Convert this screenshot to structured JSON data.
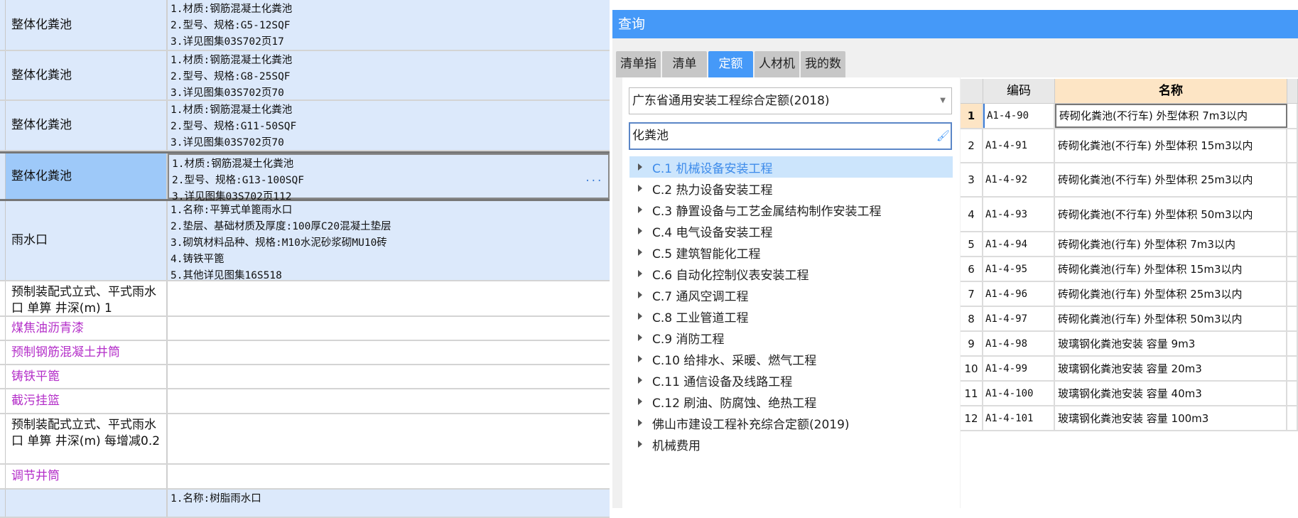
{
  "grid": {
    "rows": [
      {
        "name": "整体化粪池",
        "desc": "1.材质:钢筋混凝土化粪池\n2.型号、规格:G5-12SQF\n3.详见图集03S702页17",
        "style": "blue"
      },
      {
        "name": "整体化粪池",
        "desc": "1.材质:钢筋混凝土化粪池\n2.型号、规格:G8-25SQF\n3.详见图集03S702页70",
        "style": "blue"
      },
      {
        "name": "整体化粪池",
        "desc": "1.材质:钢筋混凝土化粪池\n2.型号、规格:G11-50SQF\n3.详见图集03S702页70",
        "style": "blue"
      },
      {
        "name": "整体化粪池",
        "desc": "1.材质:钢筋混凝土化粪池\n2.型号、规格:G13-100SQF\n3.详见图集03S702页112",
        "style": "selected"
      },
      {
        "name": "雨水口",
        "desc": "1.名称:平箅式单篦雨水口\n2.垫层、基础材质及厚度:100厚C20混凝土垫层\n3.砌筑材料品种、规格:M10水泥砂浆砌MU10砖\n4.铸铁平篦\n5.其他详见图集16S518",
        "style": "blue"
      },
      {
        "name": "预制装配式立式、平式雨水口 单箅 井深(m) 1",
        "desc": "",
        "style": "white"
      },
      {
        "name": "煤焦油沥青漆",
        "desc": "",
        "style": "purple"
      },
      {
        "name": "预制钢筋混凝土井筒",
        "desc": "",
        "style": "purple"
      },
      {
        "name": "铸铁平篦",
        "desc": "",
        "style": "purple"
      },
      {
        "name": "截污挂篮",
        "desc": "",
        "style": "purple"
      },
      {
        "name": "预制装配式立式、平式雨水口 单箅 井深(m) 每增减0.2",
        "desc": "",
        "style": "white"
      },
      {
        "name": "调节井筒",
        "desc": "",
        "style": "purple"
      },
      {
        "name": "",
        "desc": "1.名称:树脂雨水口",
        "style": "blue"
      }
    ],
    "more_icon": "ellipsis-icon"
  },
  "dialog": {
    "title": "查询",
    "tabs": [
      "清单指引",
      "清单",
      "定额",
      "人材机",
      "我的数据"
    ],
    "active_tab": "定额",
    "library": "广东省通用安装工程综合定额(2018)",
    "search_value": "化粪池",
    "tree": [
      "C.1 机械设备安装工程",
      "C.2 热力设备安装工程",
      "C.3 静置设备与工艺金属结构制作安装工程",
      "C.4 电气设备安装工程",
      "C.5 建筑智能化工程",
      "C.6 自动化控制仪表安装工程",
      "C.7 通风空调工程",
      "C.8 工业管道工程",
      "C.9 消防工程",
      "C.10 给排水、采暖、燃气工程",
      "C.11 通信设备及线路工程",
      "C.12 刷油、防腐蚀、绝热工程",
      "佛山市建设工程补充综合定额(2019)",
      "机械费用"
    ],
    "table": {
      "headers": [
        "编码",
        "名称"
      ],
      "rows": [
        {
          "i": "1",
          "code": "A1-4-90",
          "name": "砖砌化粪池(不行车) 外型体积 7m3以内"
        },
        {
          "i": "2",
          "code": "A1-4-91",
          "name": "砖砌化粪池(不行车) 外型体积 15m3以内"
        },
        {
          "i": "3",
          "code": "A1-4-92",
          "name": "砖砌化粪池(不行车) 外型体积 25m3以内"
        },
        {
          "i": "4",
          "code": "A1-4-93",
          "name": "砖砌化粪池(不行车) 外型体积 50m3以内"
        },
        {
          "i": "5",
          "code": "A1-4-94",
          "name": "砖砌化粪池(行车) 外型体积 7m3以内"
        },
        {
          "i": "6",
          "code": "A1-4-95",
          "name": "砖砌化粪池(行车) 外型体积 15m3以内"
        },
        {
          "i": "7",
          "code": "A1-4-96",
          "name": "砖砌化粪池(行车) 外型体积 25m3以内"
        },
        {
          "i": "8",
          "code": "A1-4-97",
          "name": "砖砌化粪池(行车) 外型体积 50m3以内"
        },
        {
          "i": "9",
          "code": "A1-4-98",
          "name": "玻璃钢化粪池安装 容量 9m3"
        },
        {
          "i": "10",
          "code": "A1-4-99",
          "name": "玻璃钢化粪池安装 容量 20m3"
        },
        {
          "i": "11",
          "code": "A1-4-100",
          "name": "玻璃钢化粪池安装 容量 40m3"
        },
        {
          "i": "12",
          "code": "A1-4-101",
          "name": "玻璃钢化粪池安装 容量 100m3"
        }
      ]
    },
    "colors": {
      "accent": "#4599f8",
      "selected_row": "#9ec9f9",
      "purple_text": "#b42fc9",
      "header_highlight": "#fde5c5"
    }
  }
}
